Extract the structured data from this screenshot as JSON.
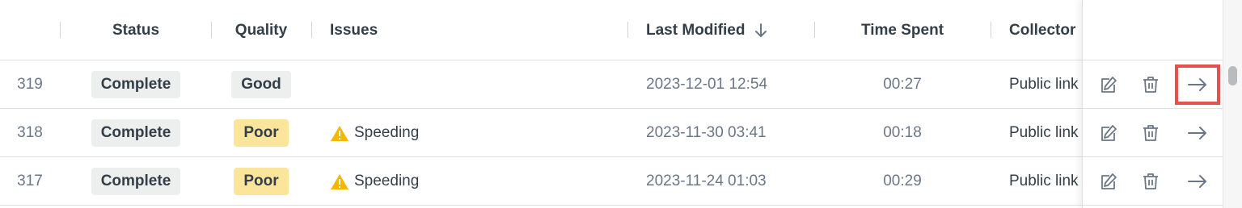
{
  "table": {
    "headers": {
      "status": "Status",
      "quality": "Quality",
      "issues": "Issues",
      "last_modified": "Last Modified",
      "time_spent": "Time Spent",
      "collector": "Collector"
    },
    "sort": {
      "column": "last_modified",
      "direction": "descending",
      "icon": "arrow-down-icon"
    },
    "rows": [
      {
        "id": "319",
        "status": "Complete",
        "quality": "Good",
        "issue": "",
        "last_modified": "2023-12-01 12:54",
        "time_spent": "00:27",
        "collector": "Public link"
      },
      {
        "id": "318",
        "status": "Complete",
        "quality": "Poor",
        "issue": "Speeding",
        "last_modified": "2023-11-30 03:41",
        "time_spent": "00:18",
        "collector": "Public link"
      },
      {
        "id": "317",
        "status": "Complete",
        "quality": "Poor",
        "issue": "Speeding",
        "last_modified": "2023-11-24 01:03",
        "time_spent": "00:29",
        "collector": "Public link"
      }
    ]
  },
  "actions": {
    "icons": [
      "edit-icon",
      "trash-icon",
      "arrow-right-icon"
    ]
  },
  "colors": {
    "quality_good_bg": "#edeeee",
    "quality_poor_bg": "#fbe59a",
    "warning": "#f5b800",
    "highlight_border": "#e4524b"
  }
}
